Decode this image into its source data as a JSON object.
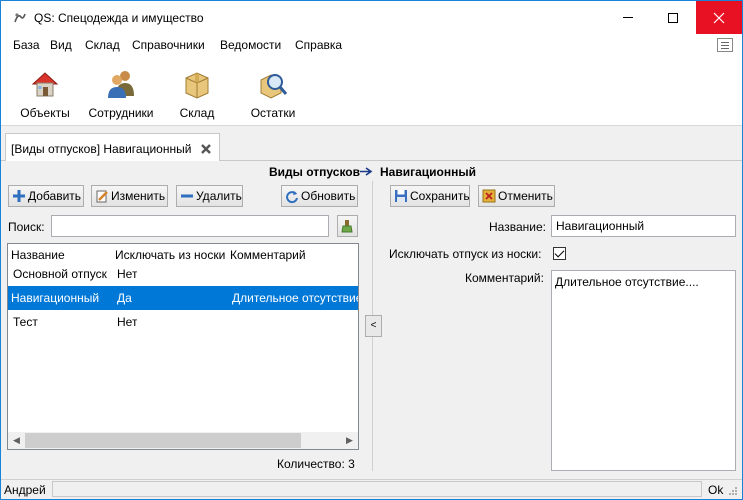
{
  "window": {
    "title": "QS: Спецодежда и имущество"
  },
  "menu": [
    "База",
    "Вид",
    "Склад",
    "Справочники",
    "Ведомости",
    "Справка"
  ],
  "toolbar": [
    {
      "label": "Объекты",
      "icon": "house-icon"
    },
    {
      "label": "Сотрудники",
      "icon": "people-icon"
    },
    {
      "label": "Склад",
      "icon": "box-icon"
    },
    {
      "label": "Остатки",
      "icon": "magnifier-icon"
    }
  ],
  "tab": {
    "label": "[Виды отпусков] Навигационный"
  },
  "breadcrumb": {
    "left": "Виды отпусков",
    "right": "Навигационный"
  },
  "list_panel": {
    "add": "Добавить",
    "edit": "Изменить",
    "delete": "Удалить",
    "refresh": "Обновить",
    "search_label": "Поиск:",
    "search_value": "",
    "columns": [
      "Название",
      "Исключать из носки",
      "Комментарий"
    ],
    "rows": [
      {
        "name": "Основной отпуск",
        "exclude": "Нет",
        "comment": ""
      },
      {
        "name": "Навигационный",
        "exclude": "Да",
        "comment": "Длительное отсутствие..."
      },
      {
        "name": "Тест",
        "exclude": "Нет",
        "comment": ""
      }
    ],
    "selected_row": 1,
    "count_text": "Количество: 3"
  },
  "detail_panel": {
    "save": "Сохранить",
    "cancel": "Отменить",
    "name_label": "Название:",
    "name_value": "Навигационный",
    "exclude_label": "Исключать отпуск из носки:",
    "exclude_checked": true,
    "comment_label": "Комментарий:",
    "comment_value": "Длительное отсутствие...."
  },
  "statusbar": {
    "user": "Андрей",
    "state": "Ok"
  },
  "colors": {
    "accent": "#0078d7",
    "close_red": "#e81123",
    "border_blue": "#1883d7"
  }
}
